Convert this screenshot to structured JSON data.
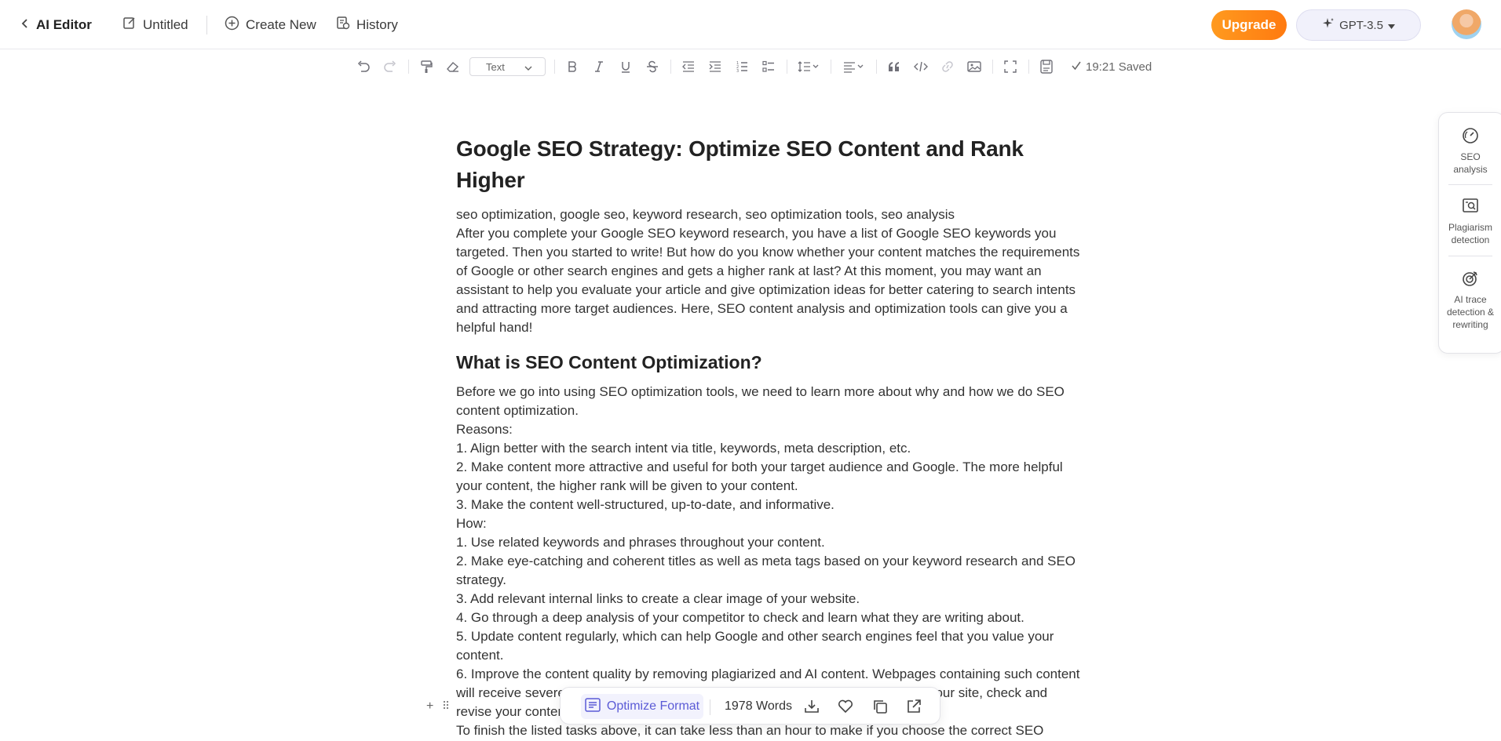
{
  "header": {
    "back_label": "AI Editor",
    "untitled_label": "Untitled",
    "create_new_label": "Create New",
    "history_label": "History",
    "upgrade_label": "Upgrade",
    "model_label": "GPT-3.5",
    "accent_upgrade": "#ff8a17"
  },
  "toolbar": {
    "text_style": "Text",
    "saved_text": "19:21 Saved"
  },
  "document": {
    "title": "Google SEO Strategy: Optimize SEO Content and Rank Higher",
    "keywords": "seo optimization, google seo, keyword research, seo optimization tools, seo analysis",
    "intro": "After you complete your Google SEO keyword research, you have a list of Google SEO keywords you targeted. Then you started to write! But how do you know whether your content matches the requirements of Google or other search engines and gets a higher rank at last? At this moment, you may want an assistant to help you evaluate your article and give optimization ideas for better catering to search intents and attracting more target audiences. Here, SEO content analysis and optimization tools can give you a helpful hand!",
    "h2": "What is SEO Content Optimization?",
    "lines": [
      "Before we go into using SEO optimization tools, we need to learn more about why and how we do SEO content optimization.",
      "Reasons:",
      "1. Align better with the search intent via title, keywords, meta description, etc.",
      "2. Make content more attractive and useful for both your target audience and Google. The more helpful your content, the higher rank will be given to your content.",
      "3. Make the content well-structured, up-to-date, and informative.",
      "How:",
      "1. Use related keywords and phrases throughout your content.",
      "2. Make eye-catching and coherent titles as well as meta tags based on your keyword research and SEO strategy.",
      "3. Add relevant internal links to create a clear image of your website.",
      "4. Go through a deep analysis of your competitor to check and learn what they are writing about.",
      "5. Update content regularly, which can help Google and other search engines feel that you value your content.",
      "6. Improve the content quality by removing plagiarized and AI content. Webpages containing such content will receive severe penalties sooner or later. Before you publish your content on your site, check and revise your content.",
      "To finish the listed tasks above, it can take less than an hour to make if you choose the correct SEO optimization tool to help you."
    ]
  },
  "side_panel": {
    "items": [
      {
        "label": "SEO analysis",
        "icon": "gauge-icon"
      },
      {
        "label": "Plagiarism detection",
        "icon": "document-search-icon"
      },
      {
        "label": "AI trace detection & rewriting",
        "icon": "target-icon"
      }
    ]
  },
  "float_bar": {
    "optimize_label": "Optimize Format",
    "word_count": "1978 Words",
    "accent": "#5b5bd6"
  }
}
